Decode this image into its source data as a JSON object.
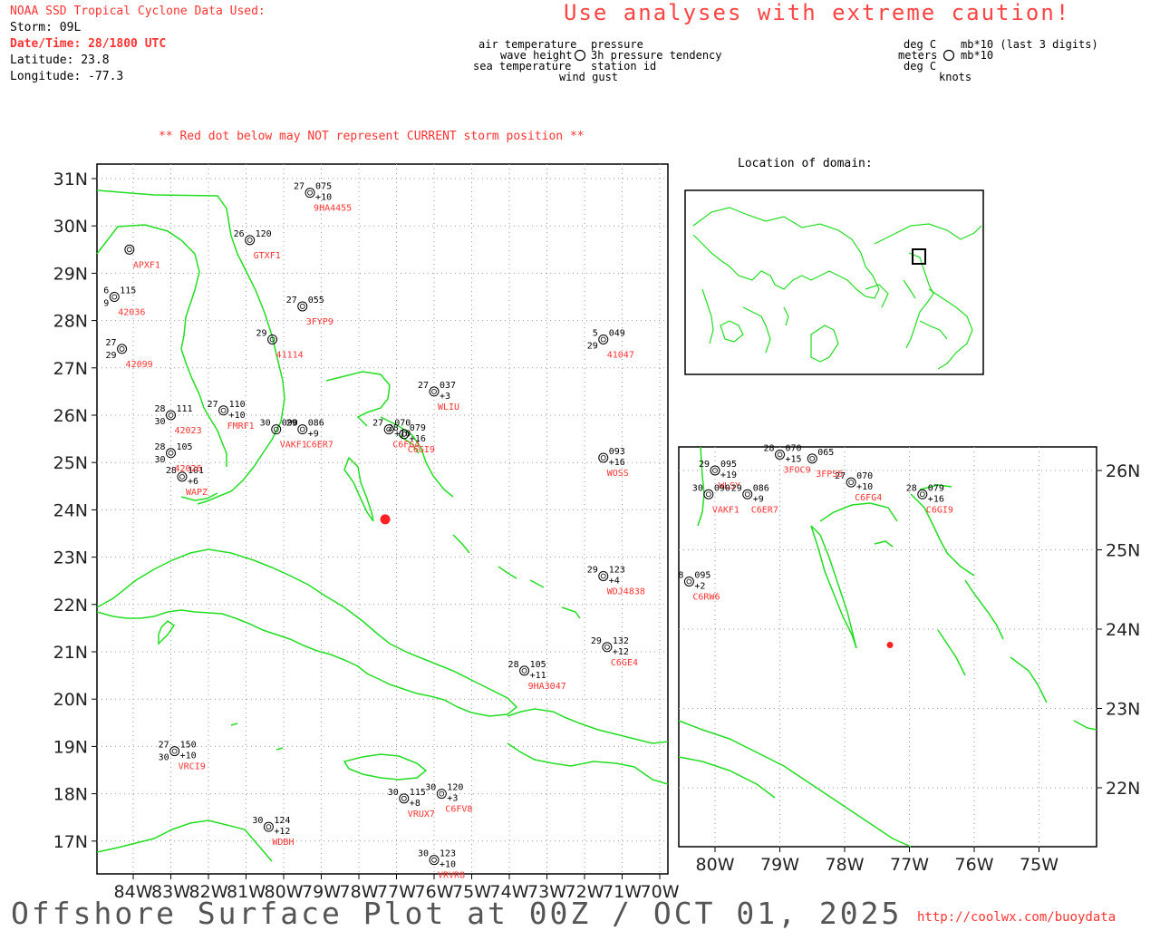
{
  "header": {
    "source": "NOAA SSD Tropical Cyclone Data Used:",
    "storm": "Storm: 09L",
    "datetime": "Date/Time: 28/1800 UTC",
    "latitude": "Latitude: 23.8",
    "longitude": "Longitude: -77.3",
    "caution": "Use analyses with extreme caution!"
  },
  "legend": {
    "left_line1": "air temperature",
    "left_line2": "wave height",
    "left_line3": "sea temperature",
    "left_line4": "wind gust",
    "mid_line1": "pressure",
    "mid_line2": "3h pressure tendency",
    "mid_line3": "station id",
    "unit_line1_left": "deg C",
    "unit_line1_right": "mb*10 (last 3 digits)",
    "unit_line2_left": "meters",
    "unit_line2_right": "mb*10",
    "unit_line3": "deg C",
    "unit_line4": "knots"
  },
  "note": "** Red dot below may NOT represent CURRENT storm position **",
  "inset_label": "Location of domain:",
  "footer": {
    "title": "Offshore Surface Plot at 00Z / OCT 01, 2025",
    "url": "http://coolwx.com/buoydata"
  },
  "main_map": {
    "lat_ticks": [
      "31N",
      "30N",
      "29N",
      "28N",
      "27N",
      "26N",
      "25N",
      "24N",
      "23N",
      "22N",
      "21N",
      "20N",
      "19N",
      "18N",
      "17N"
    ],
    "lon_ticks": [
      "84W",
      "83W",
      "82W",
      "81W",
      "80W",
      "79W",
      "78W",
      "77W",
      "76W",
      "75W",
      "74W",
      "73W",
      "72W",
      "71W",
      "70W"
    ],
    "storm_position": {
      "lat": 23.8,
      "lon": -77.3
    },
    "stations": [
      {
        "id": "9HA4455",
        "lat": 30.7,
        "lon": -79.3,
        "air": "27",
        "pres": "075",
        "tend": "+10",
        "sea": "",
        "id_color": "#ff3333"
      },
      {
        "id": "41047",
        "lat": 27.6,
        "lon": -71.5,
        "air": "5",
        "pres": "049",
        "tend": "",
        "sea": "29",
        "id_color": "#ff3333"
      },
      {
        "id": "WLIU",
        "lat": 26.5,
        "lon": -76.0,
        "air": "27",
        "pres": "037",
        "tend": "+3",
        "sea": "",
        "id_color": "#ff3333"
      },
      {
        "id": "WOSS",
        "lat": 25.1,
        "lon": -71.5,
        "air": "",
        "pres": "093",
        "tend": "+16",
        "sea": "",
        "id_color": "#ff3333"
      },
      {
        "id": "WDJ4838",
        "lat": 22.6,
        "lon": -71.5,
        "air": "29",
        "pres": "123",
        "tend": "+4",
        "sea": "",
        "id_color": "#ff3333"
      },
      {
        "id": "C6GE4",
        "lat": 21.1,
        "lon": -71.4,
        "air": "29",
        "pres": "132",
        "tend": "+12",
        "sea": "",
        "id_color": "#ff3333"
      },
      {
        "id": "9HA3047",
        "lat": 20.6,
        "lon": -73.6,
        "air": "28",
        "pres": "105",
        "tend": "+11",
        "sea": "",
        "id_color": "#ff3333"
      },
      {
        "id": "VRUX7",
        "lat": 17.9,
        "lon": -76.8,
        "air": "30",
        "pres": "115",
        "tend": "+8",
        "sea": "",
        "id_color": "#ff3333"
      },
      {
        "id": "C6FV8",
        "lat": 18.0,
        "lon": -75.8,
        "air": "30",
        "pres": "120",
        "tend": "+3",
        "sea": "",
        "id_color": "#ff3333"
      },
      {
        "id": "WDBH",
        "lat": 17.3,
        "lon": -80.4,
        "air": "30",
        "pres": "124",
        "tend": "+12",
        "sea": "",
        "id_color": "#ff3333"
      },
      {
        "id": "VRCI9",
        "lat": 18.9,
        "lon": -82.9,
        "air": "27",
        "pres": "150",
        "tend": "+10",
        "sea": "30",
        "id_color": "#ff3333"
      },
      {
        "id": "WAPZ",
        "lat": 24.7,
        "lon": -82.7,
        "air": "28",
        "pres": "101",
        "tend": "+6",
        "sea": "",
        "id_color": "#ff3333"
      },
      {
        "id": "C6ER7",
        "lat": 25.7,
        "lon": -79.5,
        "air": "29",
        "pres": "086",
        "tend": "+9",
        "sea": "",
        "id_color": "#ff3333"
      },
      {
        "id": "C6FG4",
        "lat": 25.7,
        "lon": -77.2,
        "air": "27",
        "pres": "070",
        "tend": "+10",
        "sea": "",
        "id_color": "#ff3333"
      },
      {
        "id": "C6GI9",
        "lat": 25.6,
        "lon": -76.8,
        "air": "28",
        "pres": "079",
        "tend": "+16",
        "sea": "",
        "id_color": "#ff3333"
      },
      {
        "id": "VRVR8",
        "lat": 16.6,
        "lon": -76.0,
        "air": "30",
        "pres": "123",
        "tend": "+10",
        "sea": "",
        "id_color": "#ff3333"
      },
      {
        "id": "42023",
        "lat": 26.0,
        "lon": -83.0,
        "air": "28",
        "pres": "111",
        "tend": "",
        "sea": "30",
        "id_color": "#ff3333"
      },
      {
        "id": "42099",
        "lat": 27.4,
        "lon": -84.3,
        "air": "27",
        "pres": "",
        "tend": "",
        "sea": "29",
        "id_color": "#ff3333"
      },
      {
        "id": "42036",
        "lat": 28.5,
        "lon": -84.5,
        "air": "6",
        "pres": "115",
        "tend": "",
        "sea": "9",
        "id_color": "#ff3333"
      },
      {
        "id": "42026",
        "lat": 25.2,
        "lon": -83.0,
        "air": "28",
        "pres": "105",
        "tend": "",
        "sea": "30",
        "id_color": "#ff3333"
      },
      {
        "id": "FMRF1",
        "lat": 26.1,
        "lon": -81.6,
        "air": "27",
        "pres": "110",
        "tend": "+10",
        "sea": "",
        "id_color": "#ff3333"
      },
      {
        "id": "VAKF1",
        "lat": 25.7,
        "lon": -80.2,
        "air": "30",
        "pres": "090",
        "tend": "",
        "sea": "",
        "id_color": "#ff3333"
      },
      {
        "id": "APXF1",
        "lat": 29.5,
        "lon": -84.1,
        "air": "",
        "pres": "",
        "tend": "",
        "sea": "",
        "id_color": "#ff3333"
      },
      {
        "id": "GTXF1",
        "lat": 29.7,
        "lon": -80.9,
        "air": "26",
        "pres": "120",
        "tend": "",
        "sea": "",
        "id_color": "#ff3333"
      },
      {
        "id": "3FYP9",
        "lat": 28.3,
        "lon": -79.5,
        "air": "27",
        "pres": "055",
        "tend": "",
        "sea": "",
        "id_color": "#ff3333"
      },
      {
        "id": "41114",
        "lat": 27.6,
        "lon": -80.3,
        "air": "29",
        "pres": "",
        "tend": "",
        "sea": "",
        "id_color": "#ff3333"
      }
    ]
  },
  "zoom_map": {
    "lat_ticks": [
      "26N",
      "25N",
      "24N",
      "23N",
      "22N"
    ],
    "lon_ticks": [
      "80W",
      "79W",
      "78W",
      "77W",
      "76W",
      "75W"
    ],
    "storm_position": {
      "lat": 23.8,
      "lon": -77.3
    },
    "stations": [
      {
        "id": "WLSY",
        "lat": 26.0,
        "lon": -80.0,
        "air": "29",
        "pres": "095",
        "tend": "+19",
        "sea": "",
        "id_color": "#ff3333"
      },
      {
        "id": "VAKF1",
        "lat": 25.7,
        "lon": -80.1,
        "air": "30",
        "pres": "090",
        "tend": "",
        "sea": "",
        "id_color": "#ff3333"
      },
      {
        "id": "C6ER7",
        "lat": 25.7,
        "lon": -79.5,
        "air": "29",
        "pres": "086",
        "tend": "+9",
        "sea": "",
        "id_color": "#ff3333"
      },
      {
        "id": "C6FG4",
        "lat": 25.85,
        "lon": -77.9,
        "air": "27",
        "pres": "070",
        "tend": "+10",
        "sea": "",
        "id_color": "#ff3333"
      },
      {
        "id": "C6GI9",
        "lat": 25.7,
        "lon": -76.8,
        "air": "28",
        "pres": "079",
        "tend": "+16",
        "sea": "",
        "id_color": "#ff3333"
      },
      {
        "id": "C6RW6",
        "lat": 24.6,
        "lon": -80.4,
        "air": "8",
        "pres": "095",
        "tend": "+2",
        "sea": "",
        "id_color": "#ff3333"
      },
      {
        "id": "3FOC9",
        "lat": 26.2,
        "lon": -79.0,
        "air": "28",
        "pres": "070",
        "tend": "+15",
        "sea": "",
        "id_color": "#ff3333"
      },
      {
        "id": "3FPS5",
        "lat": 26.15,
        "lon": -78.5,
        "air": "",
        "pres": "065",
        "tend": "",
        "sea": "",
        "id_color": "#ff3333"
      }
    ]
  }
}
